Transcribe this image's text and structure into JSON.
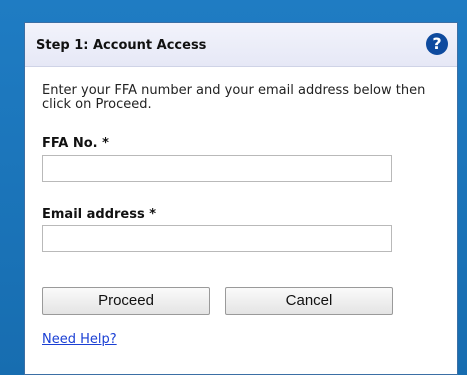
{
  "header": {
    "title": "Step 1: Account Access",
    "help_icon": "question-circle-icon"
  },
  "form": {
    "intro": "Enter your FFA number and your email address below then click on Proceed.",
    "ffa_label": "FFA No. *",
    "ffa_value": "",
    "email_label": "Email address *",
    "email_value": ""
  },
  "buttons": {
    "proceed_label": "Proceed",
    "cancel_label": "Cancel"
  },
  "links": {
    "need_help": "Need Help?"
  },
  "colors": {
    "background": "#1a73b8",
    "header_bg": "#e9ebf7",
    "help_icon": "#0e4a9e",
    "link": "#1a3fd4"
  }
}
